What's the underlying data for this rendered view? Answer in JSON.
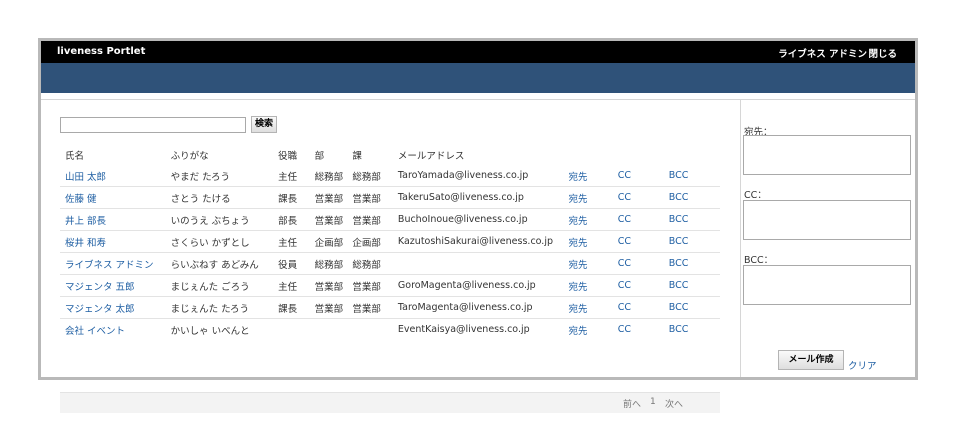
{
  "header": {
    "title": "liveness Portlet",
    "admin_name": "ライブネス アドミン",
    "close_label": "閉じる"
  },
  "search": {
    "value": "",
    "button_label": "検索"
  },
  "table": {
    "columns": [
      "氏名",
      "ふりがな",
      "役職",
      "部",
      "課",
      "メールアドレス"
    ],
    "action_labels": {
      "to": "宛先",
      "cc": "CC",
      "bcc": "BCC"
    },
    "rows": [
      {
        "name": "山田 太郎",
        "kana": "やまだ たろう",
        "position": "主任",
        "dept": "総務部",
        "section": "総務部",
        "email": "TaroYamada@liveness.co.jp"
      },
      {
        "name": "佐藤 健",
        "kana": "さとう たける",
        "position": "課長",
        "dept": "営業部",
        "section": "営業部",
        "email": "TakeruSato@liveness.co.jp"
      },
      {
        "name": "井上 部長",
        "kana": "いのうえ ぶちょう",
        "position": "部長",
        "dept": "営業部",
        "section": "営業部",
        "email": "BuchoInoue@liveness.co.jp"
      },
      {
        "name": "桜井 和寿",
        "kana": "さくらい かずとし",
        "position": "主任",
        "dept": "企画部",
        "section": "企画部",
        "email": "KazutoshiSakurai@liveness.co.jp"
      },
      {
        "name": "ライブネス アドミン",
        "kana": "らいぶねす あどみん",
        "position": "役員",
        "dept": "総務部",
        "section": "総務部",
        "email": ""
      },
      {
        "name": "マジェンタ 五郎",
        "kana": "まじぇんた ごろう",
        "position": "主任",
        "dept": "営業部",
        "section": "営業部",
        "email": "GoroMagenta@liveness.co.jp"
      },
      {
        "name": "マジェンタ 太郎",
        "kana": "まじぇんた たろう",
        "position": "課長",
        "dept": "営業部",
        "section": "営業部",
        "email": "TaroMagenta@liveness.co.jp"
      },
      {
        "name": "会社 イベント",
        "kana": "かいしゃ いべんと",
        "position": "",
        "dept": "",
        "section": "",
        "email": "EventKaisya@liveness.co.jp"
      }
    ]
  },
  "pager": {
    "prev": "前へ",
    "page": "1",
    "next": "次へ"
  },
  "sidebar": {
    "to_label": "宛先：",
    "to_value": "",
    "cc_label": "CC：",
    "cc_value": "",
    "bcc_label": "BCC：",
    "bcc_value": "",
    "compose_label": "メール作成",
    "clear_label": "クリア"
  }
}
